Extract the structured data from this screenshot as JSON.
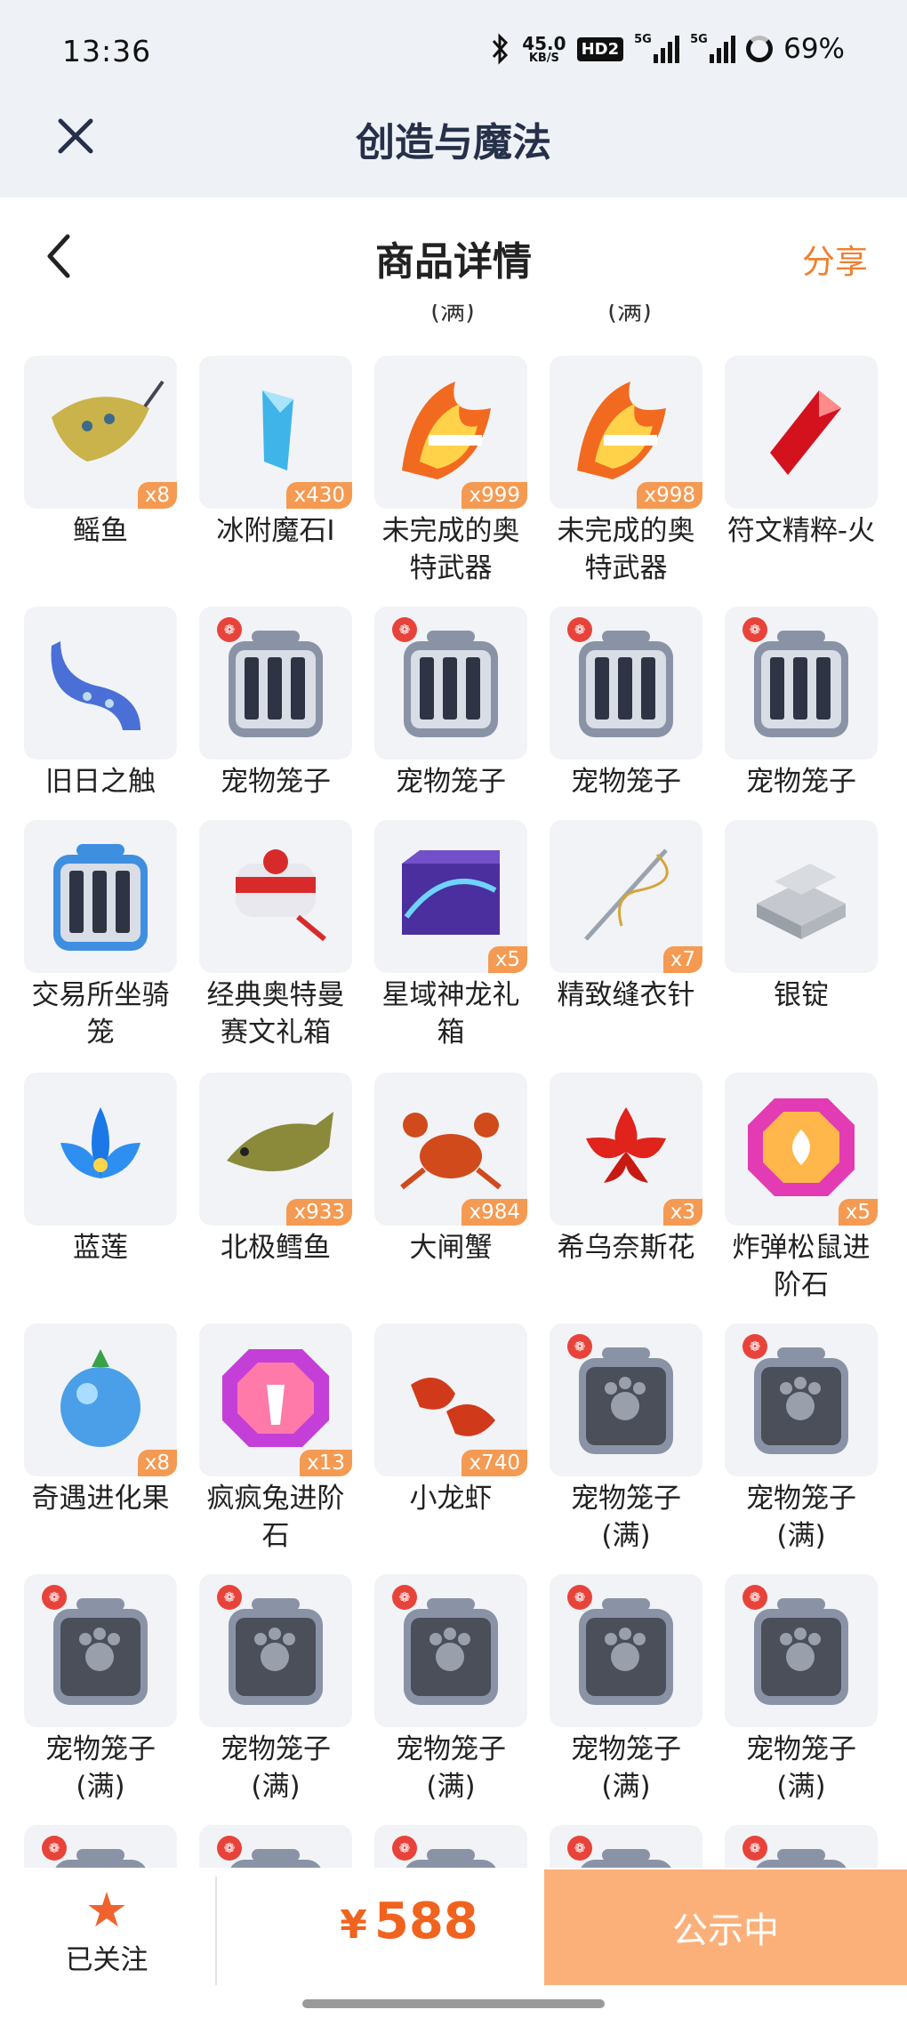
{
  "status_bar": {
    "time": "13:36",
    "net_speed_value": "45.0",
    "net_speed_unit": "KB/S",
    "hd_label": "HD2",
    "signal1_label": "5G",
    "signal2_label": "5G",
    "battery_pct": "69%"
  },
  "app_bar": {
    "title": "创造与魔法",
    "close_icon": "close-icon"
  },
  "nav": {
    "title": "商品详情",
    "share_label": "分享",
    "back_icon": "chevron-left-icon"
  },
  "prev_row_labels": [
    "(满)",
    "(满)"
  ],
  "items": [
    {
      "label": "鳐鱼",
      "qty": "x8",
      "icon": "stingray"
    },
    {
      "label": "冰附魔石I",
      "qty": "x430",
      "icon": "ice-crystal"
    },
    {
      "label": "未完成的奥特武器",
      "qty": "x999",
      "icon": "flame-weapon"
    },
    {
      "label": "未完成的奥特武器",
      "qty": "x998",
      "icon": "flame-weapon"
    },
    {
      "label": "符文精粹-火",
      "qty": "",
      "icon": "red-rune"
    },
    {
      "label": "旧日之触",
      "qty": "",
      "icon": "tentacle"
    },
    {
      "label": "宠物笼子",
      "qty": "",
      "icon": "pet-cage"
    },
    {
      "label": "宠物笼子",
      "qty": "",
      "icon": "pet-cage"
    },
    {
      "label": "宠物笼子",
      "qty": "",
      "icon": "pet-cage"
    },
    {
      "label": "宠物笼子",
      "qty": "",
      "icon": "pet-cage"
    },
    {
      "label": "交易所坐骑笼",
      "qty": "",
      "icon": "mount-cage"
    },
    {
      "label": "经典奥特曼赛文礼箱",
      "qty": "",
      "icon": "gift-box"
    },
    {
      "label": "星域神龙礼箱",
      "qty": "x5",
      "icon": "dragon-box"
    },
    {
      "label": "精致缝衣针",
      "qty": "x7",
      "icon": "needle"
    },
    {
      "label": "银锭",
      "qty": "",
      "icon": "silver-ingot"
    },
    {
      "label": "蓝莲",
      "qty": "",
      "icon": "blue-lotus"
    },
    {
      "label": "北极鳕鱼",
      "qty": "x933",
      "icon": "cod"
    },
    {
      "label": "大闸蟹",
      "qty": "x984",
      "icon": "crab"
    },
    {
      "label": "希乌奈斯花",
      "qty": "x3",
      "icon": "red-flower"
    },
    {
      "label": "炸弹松鼠进阶石",
      "qty": "x5",
      "icon": "gem-stone"
    },
    {
      "label": "奇遇进化果",
      "qty": "x8",
      "icon": "blue-fruit"
    },
    {
      "label": "疯疯兔进阶石",
      "qty": "x13",
      "icon": "gem-stone-rabbit"
    },
    {
      "label": "小龙虾",
      "qty": "x740",
      "icon": "crayfish"
    },
    {
      "label": "宠物笼子(满)",
      "qty": "",
      "icon": "full-cage"
    },
    {
      "label": "宠物笼子(满)",
      "qty": "",
      "icon": "full-cage"
    },
    {
      "label": "宠物笼子(满)",
      "qty": "",
      "icon": "full-cage"
    },
    {
      "label": "宠物笼子(满)",
      "qty": "",
      "icon": "full-cage"
    },
    {
      "label": "宠物笼子(满)",
      "qty": "",
      "icon": "full-cage"
    },
    {
      "label": "宠物笼子(满)",
      "qty": "",
      "icon": "full-cage"
    },
    {
      "label": "宠物笼子(满)",
      "qty": "",
      "icon": "full-cage"
    },
    {
      "label": "",
      "qty": "",
      "icon": "full-cage"
    },
    {
      "label": "",
      "qty": "",
      "icon": "full-cage"
    },
    {
      "label": "",
      "qty": "",
      "icon": "full-cage"
    },
    {
      "label": "",
      "qty": "",
      "icon": "full-cage"
    },
    {
      "label": "",
      "qty": "",
      "icon": "full-cage"
    }
  ],
  "bottom": {
    "follow_label": "已关注",
    "price_symbol": "¥",
    "price_value": "588",
    "status_label": "公示中"
  },
  "colors": {
    "accent": "#f0631e",
    "qty_badge": "#f59a52",
    "status_button": "#fbb07a"
  }
}
